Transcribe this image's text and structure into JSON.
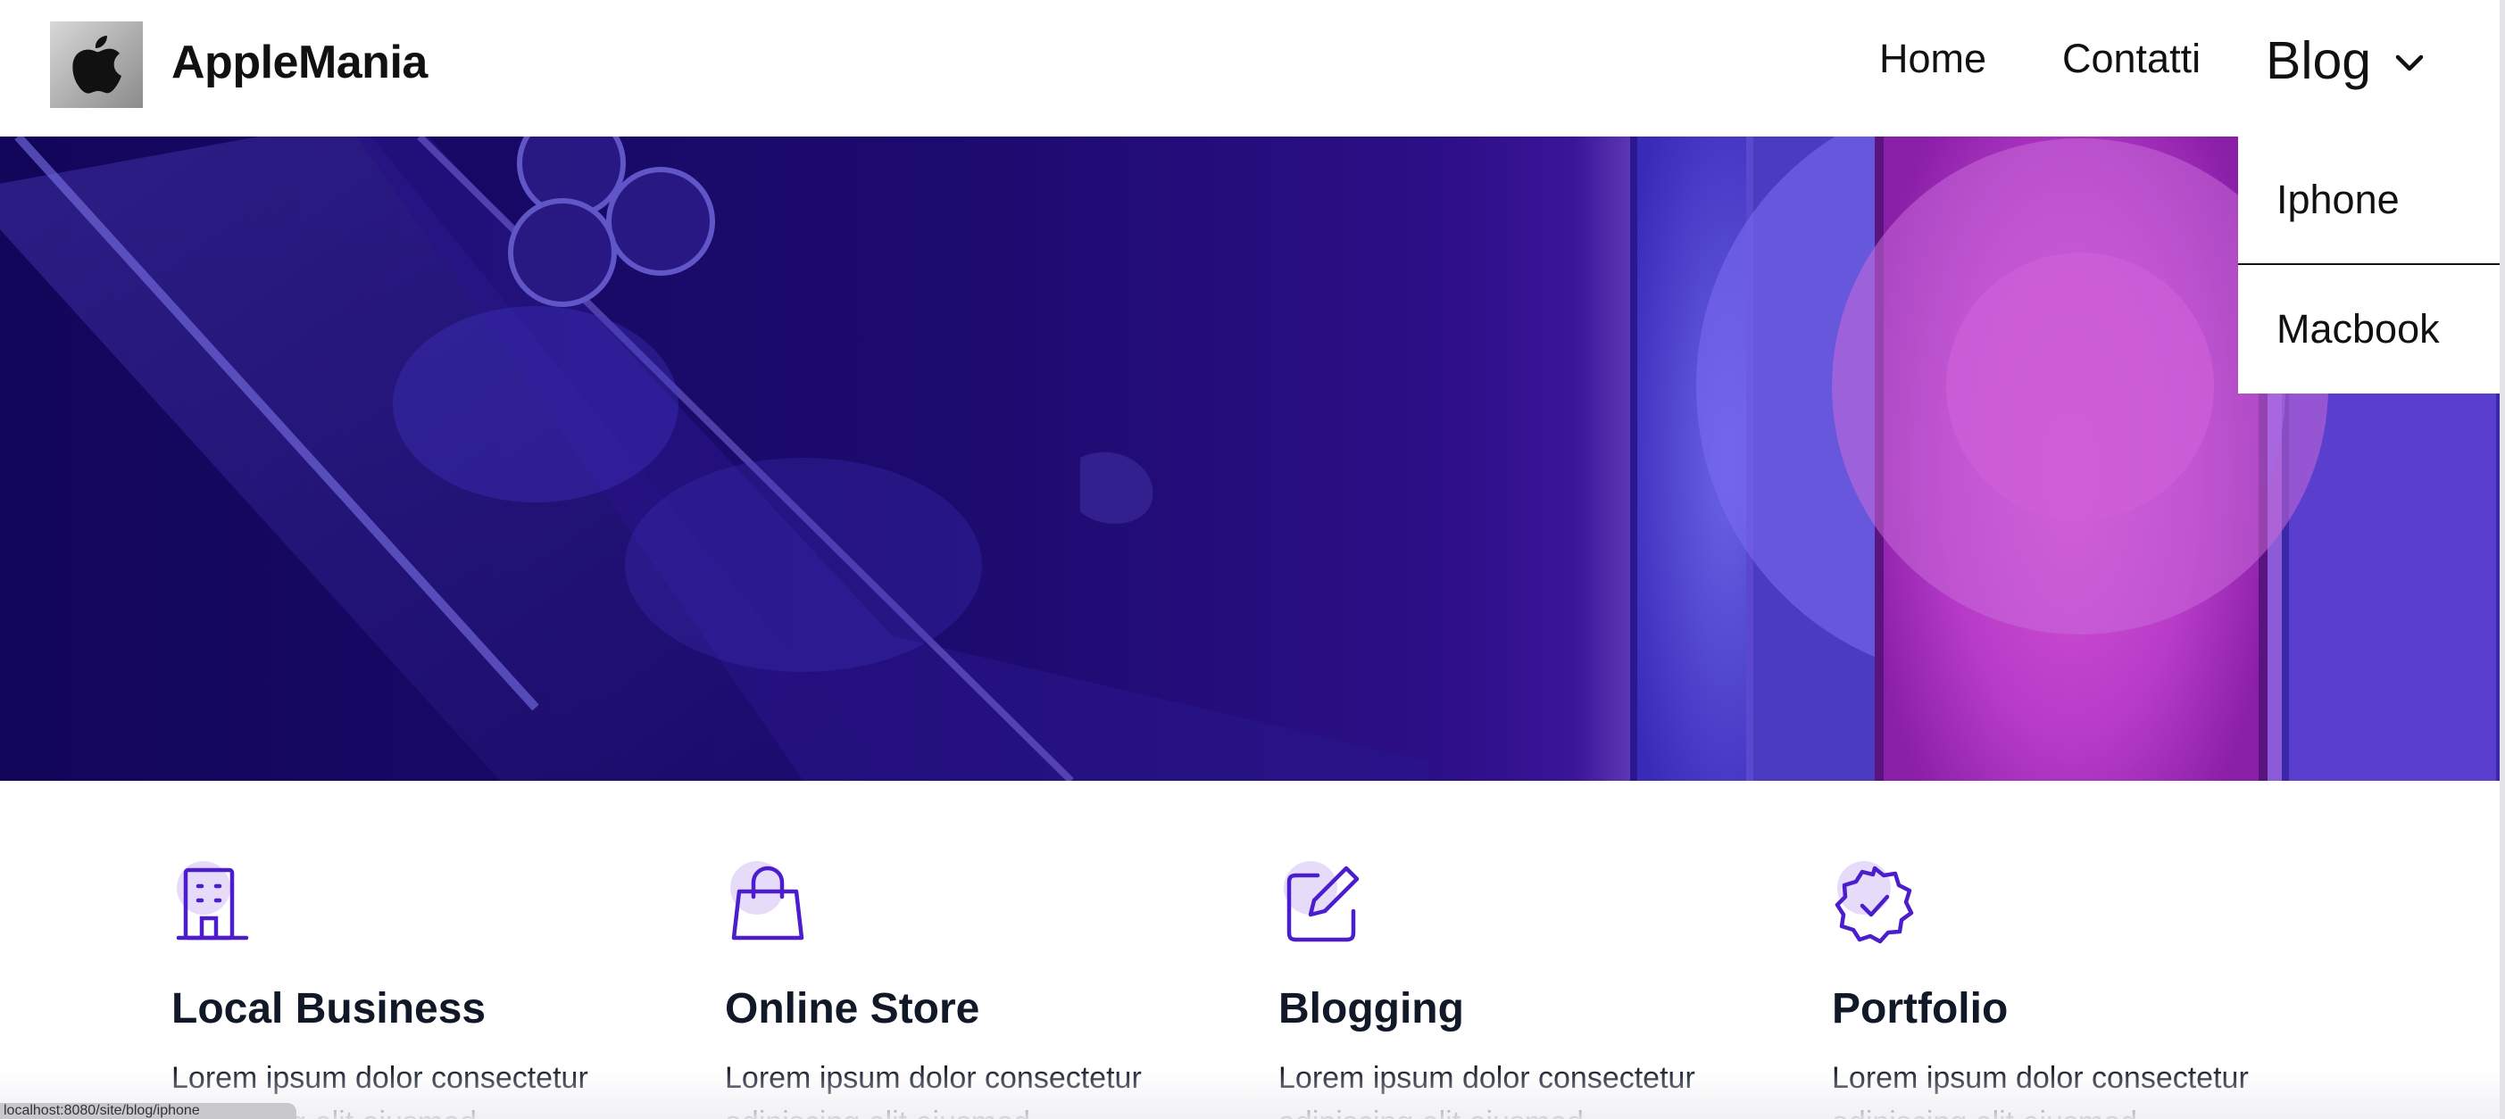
{
  "brand": {
    "name": "AppleMania"
  },
  "nav": {
    "home": "Home",
    "contatti": "Contatti",
    "blog": "Blog"
  },
  "dropdown": {
    "items": [
      {
        "label": "Iphone"
      },
      {
        "label": "Macbook"
      }
    ]
  },
  "features": [
    {
      "icon": "building-icon",
      "title": "Local Business",
      "text": "Lorem ipsum dolor consectetur adipiscing elit eiusmod."
    },
    {
      "icon": "shopping-bag-icon",
      "title": "Online Store",
      "text": "Lorem ipsum dolor consectetur adipiscing elit eiusmod."
    },
    {
      "icon": "edit-icon",
      "title": "Blogging",
      "text": "Lorem ipsum dolor consectetur adipiscing elit eiusmod."
    },
    {
      "icon": "badge-check-icon",
      "title": "Portfolio",
      "text": "Lorem ipsum dolor consectetur adipiscing elit eiusmod."
    }
  ],
  "colors": {
    "accent": "#4c1dcc",
    "accent_light": "#e6dcfa",
    "hero_dark": "#12065a",
    "hero_light": "#b58ef6"
  },
  "statusbar": {
    "text": "localhost:8080/site/blog/iphone"
  }
}
